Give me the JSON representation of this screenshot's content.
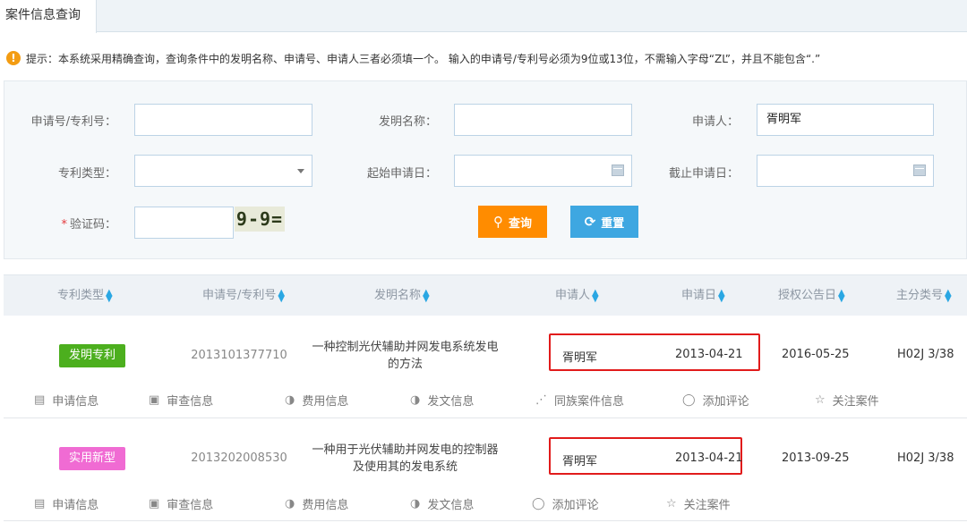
{
  "tab": {
    "title": "案件信息查询"
  },
  "tip": {
    "text": "提示：本系统采用精确查询，查询条件中的发明名称、申请号、申请人三者必须填一个。 输入的申请号/专利号必须为9位或13位，不需输入字母“ZL”，并且不能包含“.”"
  },
  "form": {
    "app_no_label": "申请号/专利号：",
    "invention_label": "发明名称：",
    "applicant_label": "申请人：",
    "applicant_value": "胥明军",
    "type_label": "专利类型：",
    "start_label": "起始申请日：",
    "end_label": "截止申请日：",
    "captcha_label": "验证码：",
    "captcha_text": "9-9=",
    "query_label": "查询",
    "reset_label": "重置"
  },
  "table": {
    "headers": [
      "专利类型",
      "申请号/专利号",
      "发明名称",
      "申请人",
      "申请日",
      "授权公告日",
      "主分类号"
    ],
    "rows": [
      {
        "type": "发明专利",
        "type_color": "#4caf1e",
        "app_no": "2013101377710",
        "title_line1": "一种控制光伏辅助并网发电系统发电",
        "title_line2": "的方法",
        "applicant": "胥明军",
        "app_date": "2013-04-21",
        "grant_date": "2016-05-25",
        "ipc": "H02J 3/38",
        "actions": [
          "申请信息",
          "审查信息",
          "费用信息",
          "发文信息",
          "同族案件信息",
          "添加评论",
          "关注案件"
        ]
      },
      {
        "type": "实用新型",
        "type_color": "#f06bd3",
        "app_no": "2013202008530",
        "title_line1": "一种用于光伏辅助并网发电的控制器",
        "title_line2": "及使用其的发电系统",
        "applicant": "胥明军",
        "app_date": "2013-04-21",
        "grant_date": "2013-09-25",
        "ipc": "H02J 3/38",
        "actions": [
          "申请信息",
          "审查信息",
          "费用信息",
          "发文信息",
          "添加评论",
          "关注案件"
        ]
      }
    ]
  }
}
